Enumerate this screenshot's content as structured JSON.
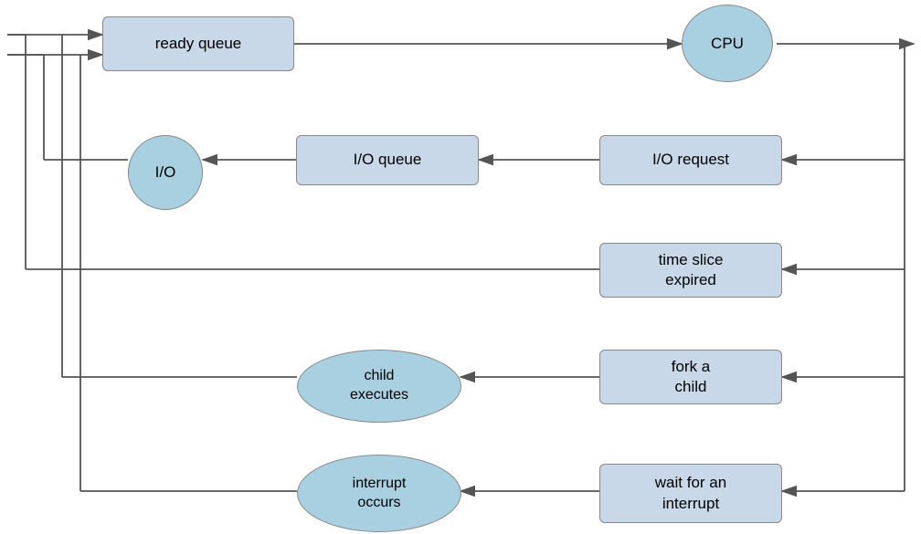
{
  "boxes": {
    "ready_queue": {
      "label": "ready queue"
    },
    "io_queue": {
      "label": "I/O queue"
    },
    "io_request": {
      "label": "I/O request"
    },
    "time_slice": {
      "label": "time slice\nexpired"
    },
    "fork_child": {
      "label": "fork a\nchild"
    },
    "wait_interrupt": {
      "label": "wait for an\ninterrupt"
    }
  },
  "circles": {
    "cpu": {
      "label": "CPU"
    },
    "io": {
      "label": "I/O"
    }
  },
  "ellipses": {
    "child_executes": {
      "label": "child\nexecutes"
    },
    "interrupt_occurs": {
      "label": "interrupt\noccurs"
    }
  }
}
